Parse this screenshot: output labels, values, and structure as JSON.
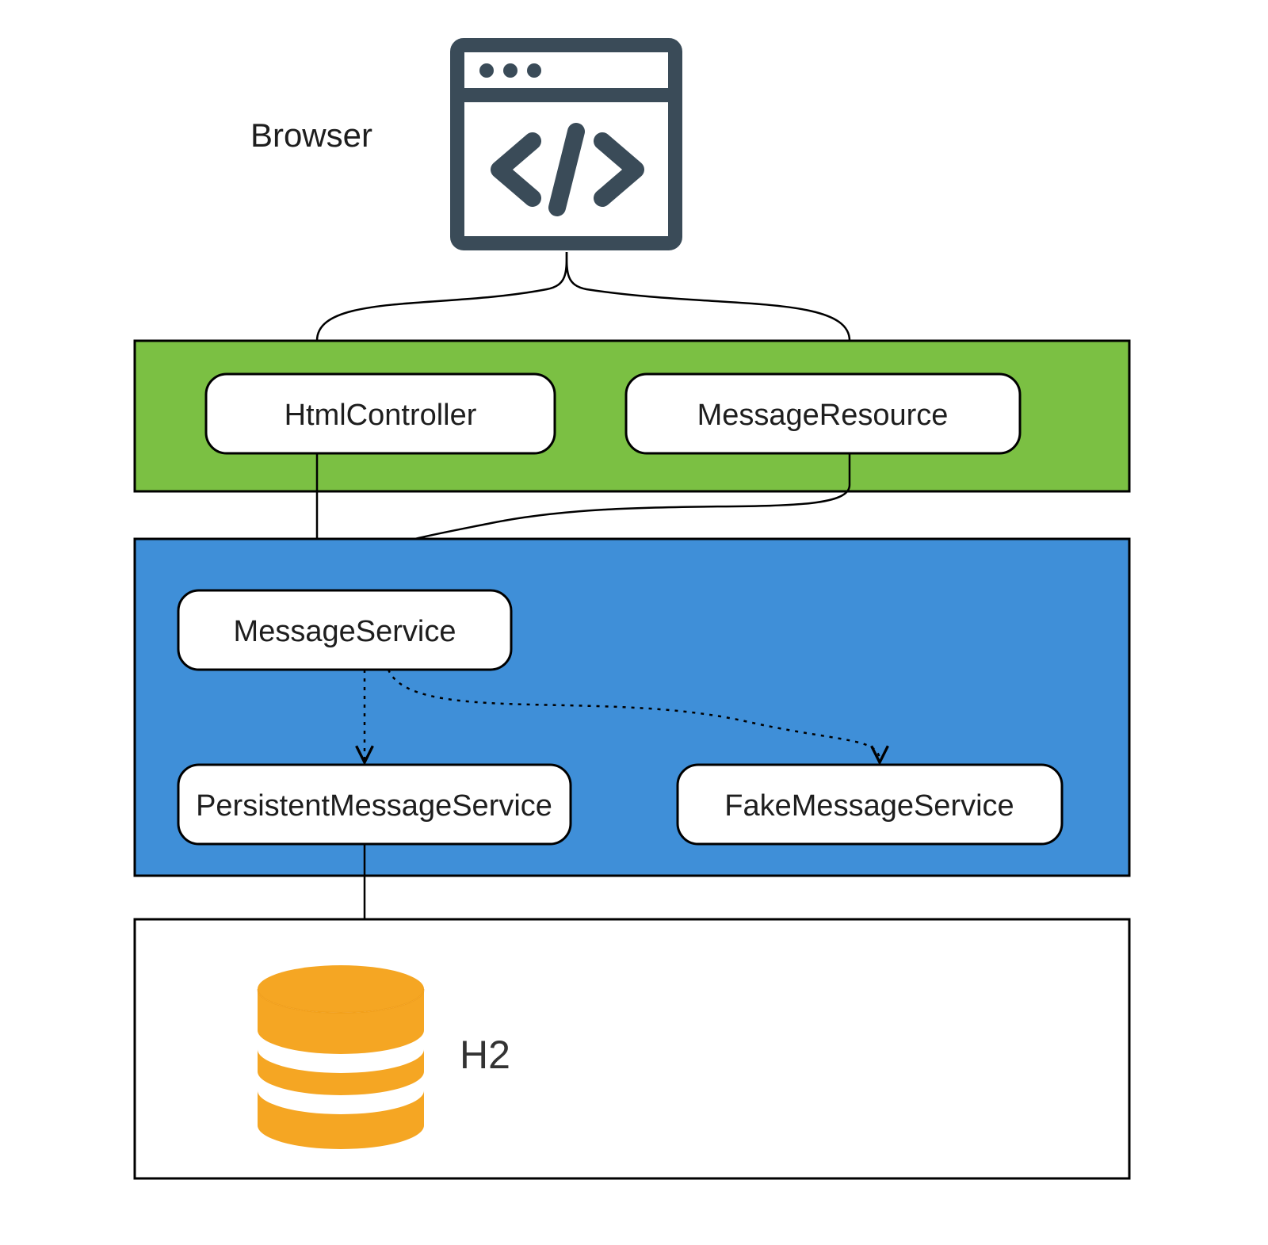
{
  "diagram": {
    "browser_label": "Browser",
    "layer_green": {
      "left_box": "HtmlController",
      "right_box": "MessageResource"
    },
    "layer_blue": {
      "top_box": "MessageService",
      "left_box": "PersistentMessageService",
      "right_box": "FakeMessageService"
    },
    "layer_db": {
      "label": "H2"
    },
    "colors": {
      "green": "#7bc043",
      "blue": "#3f8fd8",
      "icon": "#3a4b58",
      "db": "#f5a623",
      "stroke": "#000000"
    },
    "icons": {
      "browser_icon": "browser-code-icon",
      "database_icon": "database-icon"
    }
  }
}
